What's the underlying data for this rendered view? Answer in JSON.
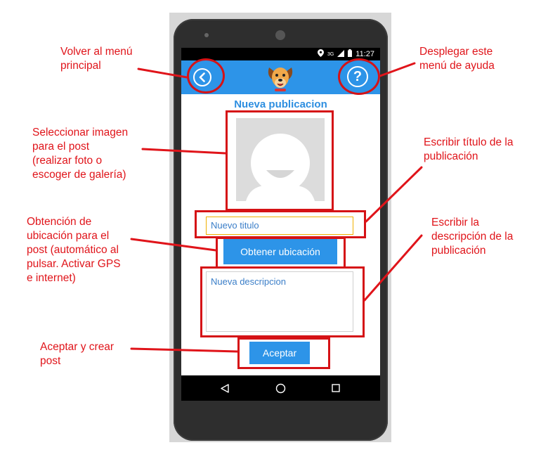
{
  "annotations": {
    "volver": "Volver al menú\nprincipal",
    "ayuda": "Desplegar este\nmenú de ayuda",
    "imagen": "Seleccionar imagen\npara el post\n(realizar foto o\nescoger de galería)",
    "titulo": "Escribir título de la\npublicación",
    "ubicacion": "Obtención de\nubicación para el\npost (automático al\npulsar. Activar GPS\ne internet)",
    "descripcion": "Escribir la\ndescripción de la\npublicación",
    "aceptar": "Aceptar y crear\npost"
  },
  "status_bar": {
    "time": "11:27",
    "network": "3G"
  },
  "app_bar": {
    "back_icon": "chevron-left-icon",
    "logo_icon": "dog-logo-icon",
    "help_label": "?"
  },
  "form": {
    "title": "Nueva publicacion",
    "title_input_placeholder": "Nuevo titulo",
    "location_button": "Obtener ubicación",
    "description_placeholder": "Nueva descripcion",
    "accept_button": "Aceptar"
  },
  "colors": {
    "accent": "#2d94e8",
    "annotation": "#e0141a",
    "highlight_box": "#d51216"
  }
}
